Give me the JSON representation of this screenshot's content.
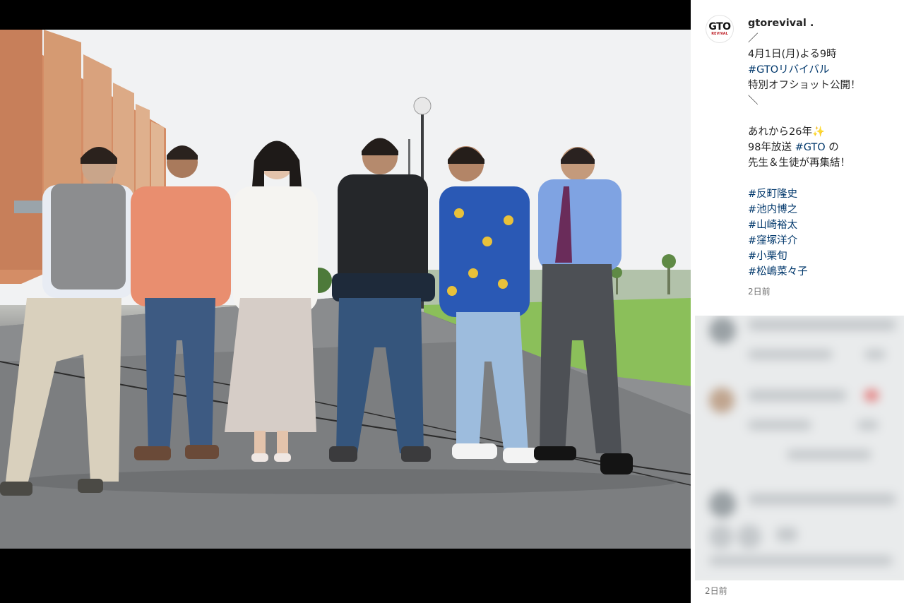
{
  "post": {
    "username": "gtorevival .",
    "avatar_logo": "GTO",
    "avatar_logo_sub": "REVIVAL",
    "caption_lines": [
      "／",
      "4月1日(月)よる9時"
    ],
    "hashtag_show": "#GTOリバイバル",
    "line_announce": "特別オフショット公開！",
    "line_close": "＼",
    "line_years": "あれから26年",
    "sparkle": "✨",
    "line_broadcast_pre": "98年放送 ",
    "hashtag_gto": "#GTO",
    "line_broadcast_post": " の",
    "line_reunion": "先生＆生徒が再集結！",
    "cast_hashtags": [
      "#反町隆史",
      "#池内博之",
      "#山崎裕太",
      "#窪塚洋介",
      "#小栗旬",
      "#松嶋菜々子"
    ],
    "timestamp": "2日前"
  },
  "footer": {
    "timestamp": "2日前"
  },
  "colors": {
    "hashtag": "#00376b",
    "text": "#262626",
    "muted": "#737373",
    "logo_accent": "#c0262d"
  }
}
